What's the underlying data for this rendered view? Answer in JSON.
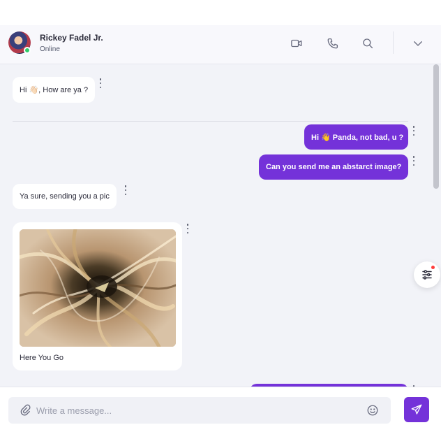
{
  "header": {
    "contact_name": "Rickey Fadel Jr.",
    "contact_status": "Online",
    "icons": [
      "video-icon",
      "phone-icon",
      "search-icon",
      "chevron-down-icon"
    ]
  },
  "messages": [
    {
      "direction": "incoming",
      "text": "Hi 👋🏻, How are ya ?"
    },
    {
      "direction": "outgoing",
      "text": "Hi 👋 Panda, not bad, u ?"
    },
    {
      "direction": "outgoing",
      "text": "Can you send me an abstarct image?"
    },
    {
      "direction": "incoming",
      "text": "Ya sure, sending you a pic"
    },
    {
      "direction": "incoming",
      "type": "image",
      "caption": "Here You Go"
    }
  ],
  "composer": {
    "placeholder": "Write a message...",
    "value": ""
  },
  "colors": {
    "accent": "#7432d9",
    "online": "#2fcb6b",
    "notification": "#ff3b3b"
  }
}
